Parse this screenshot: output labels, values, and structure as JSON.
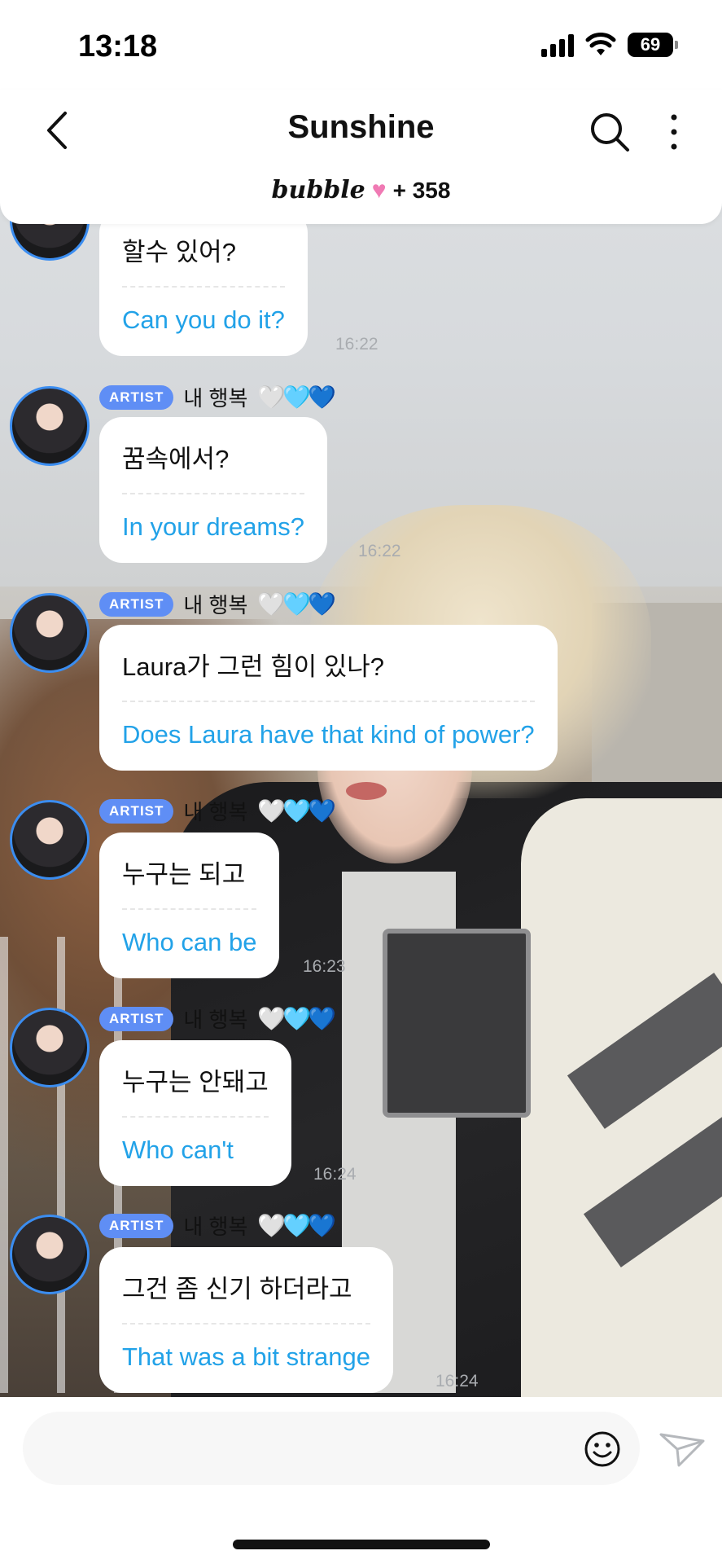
{
  "status_bar": {
    "time": "13:18",
    "battery": "69"
  },
  "header": {
    "title": "Sunshine",
    "brand": "bubble",
    "count": "+ 358"
  },
  "messages": [
    {
      "ko": "할수 있어?",
      "en": "Can you do it?",
      "time": "16:22"
    },
    {
      "badge": "ARTIST",
      "name": "내 행복",
      "hearts": "🤍🩵💙",
      "ko": "꿈속에서?",
      "en": "In your dreams?",
      "time": "16:22"
    },
    {
      "badge": "ARTIST",
      "name": "내 행복",
      "hearts": "🤍🩵💙",
      "ko": "Laura가 그런 힘이 있나?",
      "en": "Does Laura have that kind of power?",
      "time": ""
    },
    {
      "badge": "ARTIST",
      "name": "내 행복",
      "hearts": "🤍🩵💙",
      "ko": "누구는 되고",
      "en": "Who can be",
      "time": "16:23"
    },
    {
      "badge": "ARTIST",
      "name": "내 행복",
      "hearts": "🤍🩵💙",
      "ko": "누구는 안돼고",
      "en": "Who can't",
      "time": "16:24"
    },
    {
      "badge": "ARTIST",
      "name": "내 행복",
      "hearts": "🤍🩵💙",
      "ko": "그건 좀 신기 하더라고",
      "en": "That was a bit strange",
      "time": "16:24"
    }
  ],
  "colors": {
    "accent": "#22a2e8",
    "badge": "#5f8ef5",
    "avatar_ring": "#3b8df0",
    "heart": "#f07ab4"
  },
  "icons": [
    "back-arrow-icon",
    "search-icon",
    "more-vertical-icon",
    "heart-icon",
    "emoji-icon",
    "send-icon",
    "wifi-icon",
    "signal-icon",
    "battery-icon"
  ]
}
